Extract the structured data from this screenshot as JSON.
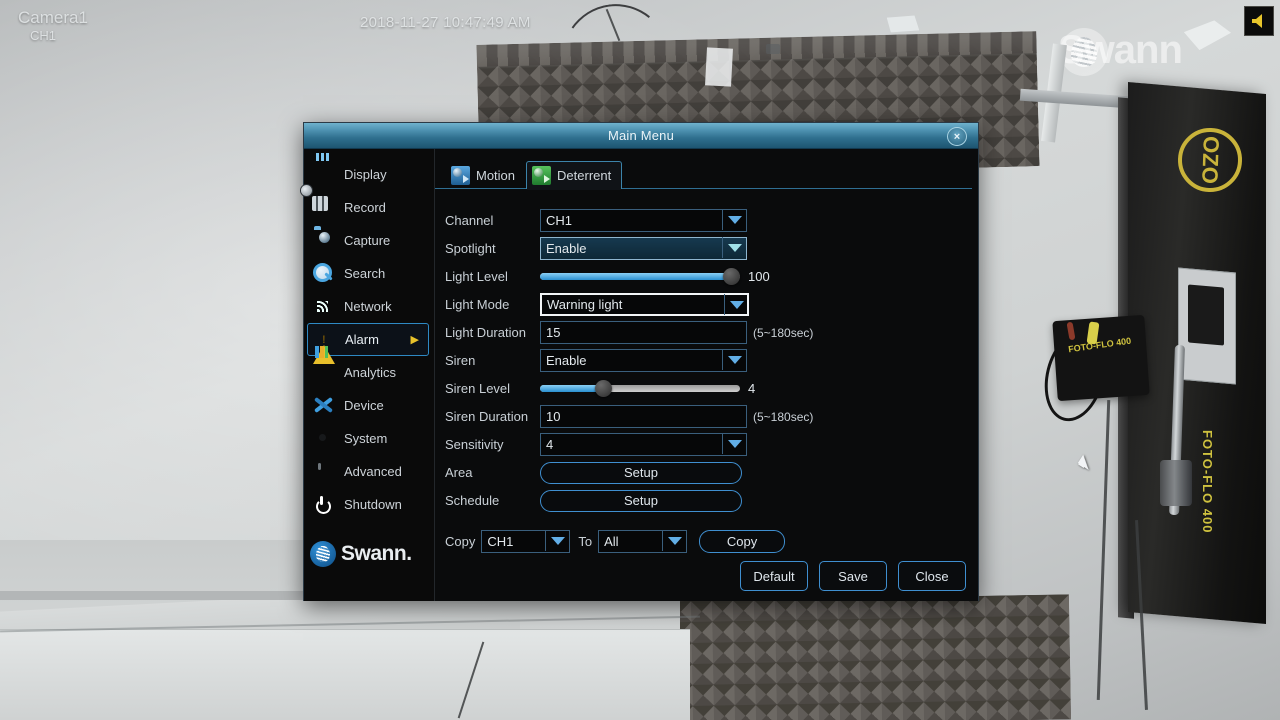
{
  "osd": {
    "camera_label": "Camera1",
    "channel_label": "CH1",
    "timestamp": "2018-11-27 10:47:49 AM",
    "audio_icon": "speaker-icon",
    "watermark": "Swann"
  },
  "window": {
    "title": "Main Menu",
    "close_label": "×"
  },
  "sidebar": {
    "items": [
      {
        "label": "Display",
        "icon": "display-icon",
        "selected": false
      },
      {
        "label": "Record",
        "icon": "record-icon",
        "selected": false
      },
      {
        "label": "Capture",
        "icon": "capture-icon",
        "selected": false
      },
      {
        "label": "Search",
        "icon": "search-icon",
        "selected": false
      },
      {
        "label": "Network",
        "icon": "network-icon",
        "selected": false
      },
      {
        "label": "Alarm",
        "icon": "alarm-icon",
        "selected": true,
        "arrow": "▶"
      },
      {
        "label": "Analytics",
        "icon": "analytics-icon",
        "selected": false
      },
      {
        "label": "Device",
        "icon": "device-icon",
        "selected": false
      },
      {
        "label": "System",
        "icon": "system-icon",
        "selected": false
      },
      {
        "label": "Advanced",
        "icon": "advanced-icon",
        "selected": false
      },
      {
        "label": "Shutdown",
        "icon": "shutdown-icon",
        "selected": false
      }
    ],
    "brand": "Swann"
  },
  "tabs": [
    {
      "label": "Motion",
      "icon": "motion-icon",
      "active": false
    },
    {
      "label": "Deterrent",
      "icon": "deterrent-icon",
      "active": true
    }
  ],
  "form": {
    "channel": {
      "label": "Channel",
      "value": "CH1"
    },
    "spotlight": {
      "label": "Spotlight",
      "value": "Enable"
    },
    "light_level": {
      "label": "Light Level",
      "value": "100",
      "percent": 100
    },
    "light_mode": {
      "label": "Light Mode",
      "value": "Warning light"
    },
    "light_duration": {
      "label": "Light Duration",
      "value": "15",
      "hint": "(5~180sec)"
    },
    "siren": {
      "label": "Siren",
      "value": "Enable"
    },
    "siren_level": {
      "label": "Siren Level",
      "value": "4",
      "percent": 30
    },
    "siren_duration": {
      "label": "Siren Duration",
      "value": "10",
      "hint": "(5~180sec)"
    },
    "sensitivity": {
      "label": "Sensitivity",
      "value": "4"
    },
    "area": {
      "label": "Area",
      "button": "Setup"
    },
    "schedule": {
      "label": "Schedule",
      "button": "Setup"
    }
  },
  "copy_row": {
    "copy_label": "Copy",
    "source": "CH1",
    "to_label": "To",
    "target": "All",
    "button": "Copy"
  },
  "footer": {
    "default": "Default",
    "save": "Save",
    "close": "Close"
  },
  "colors": {
    "accent": "#3f8fd0",
    "title_bar": "#2f6f8e",
    "selected_border": "#2e89c4",
    "slider_fill": "#2a8fd0",
    "warning": "#e8bf2b"
  }
}
